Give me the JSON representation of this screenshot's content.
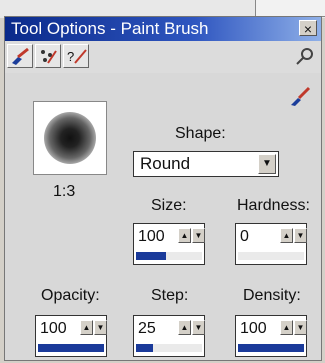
{
  "window": {
    "title": "Tool Options - Paint Brush",
    "close_label": "×"
  },
  "toolbar": {
    "items": [
      {
        "name": "brush-tab-icon"
      },
      {
        "name": "effects-tab-icon"
      },
      {
        "name": "help-brush-tab-icon"
      }
    ],
    "right_icon": "magnify-icon"
  },
  "preview": {
    "ratio": "1:3"
  },
  "shape": {
    "label": "Shape:",
    "value": "Round"
  },
  "size": {
    "label": "Size:",
    "value": "100",
    "level": 0.45
  },
  "hardness": {
    "label": "Hardness:",
    "value": "0",
    "level": 0.0
  },
  "opacity": {
    "label": "Opacity:",
    "value": "100",
    "level": 1.0
  },
  "step": {
    "label": "Step:",
    "value": "25",
    "level": 0.25
  },
  "density": {
    "label": "Density:",
    "value": "100",
    "level": 1.0
  },
  "colors": {
    "title_from": "#0a2a8a",
    "title_to": "#8fb0e8",
    "slider_fill": "#1a3a9a"
  }
}
